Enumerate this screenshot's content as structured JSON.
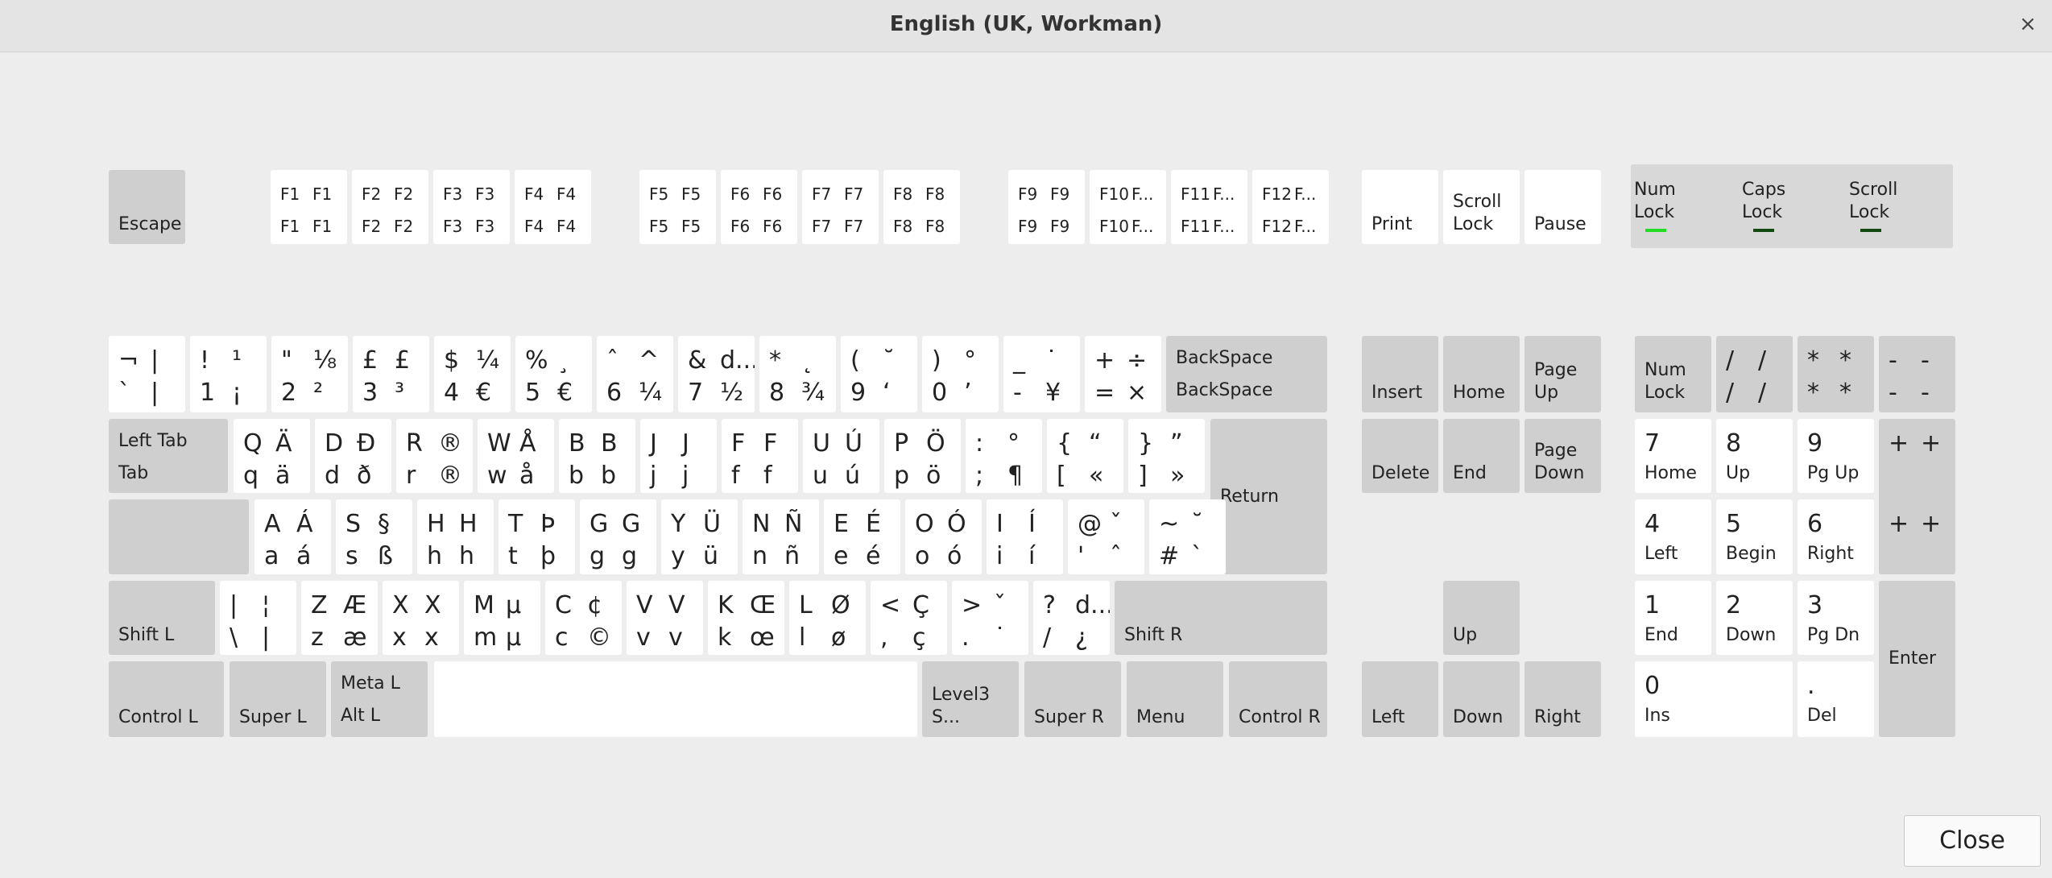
{
  "window": {
    "title": "English (UK, Workman)",
    "close_glyph": "×"
  },
  "close_button": "Close",
  "indicators": [
    {
      "label": "Num\nLock",
      "active": true,
      "color": "#22dd22"
    },
    {
      "label": "Caps\nLock",
      "active": false,
      "color": "#124a12"
    },
    {
      "label": "Scroll\nLock",
      "active": false,
      "color": "#124a12"
    }
  ],
  "colors": {
    "key_normal": "#ffffff",
    "key_special": "#cfcfcf",
    "background": "#ededed",
    "titlebar": "#e4e4e4"
  },
  "keys": {
    "fn": {
      "escape": "Escape",
      "f": [
        {
          "tl": "F1",
          "tr": "F1",
          "bl": "F1",
          "br": "F1"
        },
        {
          "tl": "F2",
          "tr": "F2",
          "bl": "F2",
          "br": "F2"
        },
        {
          "tl": "F3",
          "tr": "F3",
          "bl": "F3",
          "br": "F3"
        },
        {
          "tl": "F4",
          "tr": "F4",
          "bl": "F4",
          "br": "F4"
        },
        {
          "tl": "F5",
          "tr": "F5",
          "bl": "F5",
          "br": "F5"
        },
        {
          "tl": "F6",
          "tr": "F6",
          "bl": "F6",
          "br": "F6"
        },
        {
          "tl": "F7",
          "tr": "F7",
          "bl": "F7",
          "br": "F7"
        },
        {
          "tl": "F8",
          "tr": "F8",
          "bl": "F8",
          "br": "F8"
        },
        {
          "tl": "F9",
          "tr": "F9",
          "bl": "F9",
          "br": "F9"
        },
        {
          "tl": "F10",
          "tr": "F...",
          "bl": "F10",
          "br": "F..."
        },
        {
          "tl": "F11",
          "tr": "F...",
          "bl": "F11",
          "br": "F..."
        },
        {
          "tl": "F12",
          "tr": "F...",
          "bl": "F12",
          "br": "F..."
        }
      ],
      "print": "Print",
      "scroll_lock": "Scroll\nLock",
      "pause": "Pause"
    },
    "number_row": [
      {
        "tl": "¬",
        "tr": "|",
        "bl": "`",
        "br": "|"
      },
      {
        "tl": "!",
        "tr": "¹",
        "bl": "1",
        "br": "¡"
      },
      {
        "tl": "\"",
        "tr": "⅛",
        "bl": "2",
        "br": "²"
      },
      {
        "tl": "£",
        "tr": "£",
        "bl": "3",
        "br": "³"
      },
      {
        "tl": "$",
        "tr": "¼",
        "bl": "4",
        "br": "€"
      },
      {
        "tl": "%",
        "tr": "¸",
        "bl": "5",
        "br": "€"
      },
      {
        "tl": "ˆ",
        "tr": "^",
        "bl": "6",
        "br": "¼"
      },
      {
        "tl": "&",
        "tr": "d...",
        "bl": "7",
        "br": "½"
      },
      {
        "tl": "*",
        "tr": "˛",
        "bl": "8",
        "br": "¾"
      },
      {
        "tl": "(",
        "tr": "˘",
        "bl": "9",
        "br": "‘"
      },
      {
        "tl": ")",
        "tr": "°",
        "bl": "0",
        "br": "’"
      },
      {
        "tl": "_",
        "tr": "˙",
        "bl": "-",
        "br": "¥"
      },
      {
        "tl": "+",
        "tr": "÷",
        "bl": "=",
        "br": "×"
      }
    ],
    "backspace": {
      "top": "BackSpace",
      "bottom": "BackSpace"
    },
    "tab": {
      "top": "Left Tab",
      "bottom": "Tab"
    },
    "top_row": [
      {
        "tl": "Q",
        "tr": "Ä",
        "bl": "q",
        "br": "ä"
      },
      {
        "tl": "D",
        "tr": "Đ",
        "bl": "d",
        "br": "ð"
      },
      {
        "tl": "R",
        "tr": "®",
        "bl": "r",
        "br": "®"
      },
      {
        "tl": "W",
        "tr": "Å",
        "bl": "w",
        "br": "å"
      },
      {
        "tl": "B",
        "tr": "B",
        "bl": "b",
        "br": "b"
      },
      {
        "tl": "J",
        "tr": "J",
        "bl": "j",
        "br": "j"
      },
      {
        "tl": "F",
        "tr": "F",
        "bl": "f",
        "br": "f"
      },
      {
        "tl": "U",
        "tr": "Ú",
        "bl": "u",
        "br": "ú"
      },
      {
        "tl": "P",
        "tr": "Ö",
        "bl": "p",
        "br": "ö"
      },
      {
        "tl": ":",
        "tr": "°",
        "bl": ";",
        "br": "¶"
      },
      {
        "tl": "{",
        "tr": "“",
        "bl": "[",
        "br": "«"
      },
      {
        "tl": "}",
        "tr": "”",
        "bl": "]",
        "br": "»"
      }
    ],
    "return": "Return",
    "home_row": [
      {
        "tl": "A",
        "tr": "Á",
        "bl": "a",
        "br": "á"
      },
      {
        "tl": "S",
        "tr": "§",
        "bl": "s",
        "br": "ß"
      },
      {
        "tl": "H",
        "tr": "H",
        "bl": "h",
        "br": "h"
      },
      {
        "tl": "T",
        "tr": "Þ",
        "bl": "t",
        "br": "þ"
      },
      {
        "tl": "G",
        "tr": "G",
        "bl": "g",
        "br": "g"
      },
      {
        "tl": "Y",
        "tr": "Ü",
        "bl": "y",
        "br": "ü"
      },
      {
        "tl": "N",
        "tr": "Ñ",
        "bl": "n",
        "br": "ñ"
      },
      {
        "tl": "E",
        "tr": "É",
        "bl": "e",
        "br": "é"
      },
      {
        "tl": "O",
        "tr": "Ó",
        "bl": "o",
        "br": "ó"
      },
      {
        "tl": "I",
        "tr": "Í",
        "bl": "i",
        "br": "í"
      },
      {
        "tl": "@",
        "tr": "ˇ",
        "bl": "'",
        "br": "ˆ"
      },
      {
        "tl": "~",
        "tr": "˘",
        "bl": "#",
        "br": "`"
      }
    ],
    "shift_l": "Shift L",
    "bottom_row": [
      {
        "tl": "|",
        "tr": "¦",
        "bl": "\\",
        "br": "|"
      },
      {
        "tl": "Z",
        "tr": "Æ",
        "bl": "z",
        "br": "æ"
      },
      {
        "tl": "X",
        "tr": "X",
        "bl": "x",
        "br": "x"
      },
      {
        "tl": "M",
        "tr": "µ",
        "bl": "m",
        "br": "µ"
      },
      {
        "tl": "C",
        "tr": "¢",
        "bl": "c",
        "br": "©"
      },
      {
        "tl": "V",
        "tr": "V",
        "bl": "v",
        "br": "v"
      },
      {
        "tl": "K",
        "tr": "Œ",
        "bl": "k",
        "br": "œ"
      },
      {
        "tl": "L",
        "tr": "Ø",
        "bl": "l",
        "br": "ø"
      },
      {
        "tl": "<",
        "tr": "Ç",
        "bl": ",",
        "br": "ç"
      },
      {
        "tl": ">",
        "tr": "ˇ",
        "bl": ".",
        "br": "˙"
      },
      {
        "tl": "?",
        "tr": "d...",
        "bl": "/",
        "br": "¿"
      }
    ],
    "shift_r": "Shift R",
    "space_row": {
      "control_l": "Control L",
      "super_l": "Super L",
      "alt_top": "Meta L",
      "alt_bottom": "Alt L",
      "space": "",
      "level3": "Level3 S...",
      "super_r": "Super R",
      "menu": "Menu",
      "control_r": "Control R"
    },
    "nav": {
      "insert": "Insert",
      "home": "Home",
      "page_up": "Page\nUp",
      "delete": "Delete",
      "end": "End",
      "page_down": "Page\nDown",
      "up": "Up",
      "left": "Left",
      "down": "Down",
      "right": "Right"
    },
    "numpad": {
      "num_lock": "Num\nLock",
      "divide": {
        "tl": "/",
        "tr": "/",
        "bl": "/",
        "br": "/"
      },
      "multiply": {
        "tl": "*",
        "tr": "*",
        "bl": "*",
        "br": "*"
      },
      "minus": {
        "tl": "-",
        "tr": "-",
        "bl": "-",
        "br": "-"
      },
      "plus_top": {
        "a": "+",
        "b": "+"
      },
      "plus_bottom": {
        "a": "+",
        "b": "+"
      },
      "n7": {
        "big": "7",
        "sub": "Home"
      },
      "n8": {
        "big": "8",
        "sub": "Up"
      },
      "n9": {
        "big": "9",
        "sub": "Pg Up"
      },
      "n4": {
        "big": "4",
        "sub": "Left"
      },
      "n5": {
        "big": "5",
        "sub": "Begin"
      },
      "n6": {
        "big": "6",
        "sub": "Right"
      },
      "n1": {
        "big": "1",
        "sub": "End"
      },
      "n2": {
        "big": "2",
        "sub": "Down"
      },
      "n3": {
        "big": "3",
        "sub": "Pg Dn"
      },
      "n0": {
        "big": "0",
        "sub": "Ins"
      },
      "decimal": {
        "big": ".",
        "sub": "Del"
      },
      "enter": "Enter"
    }
  }
}
